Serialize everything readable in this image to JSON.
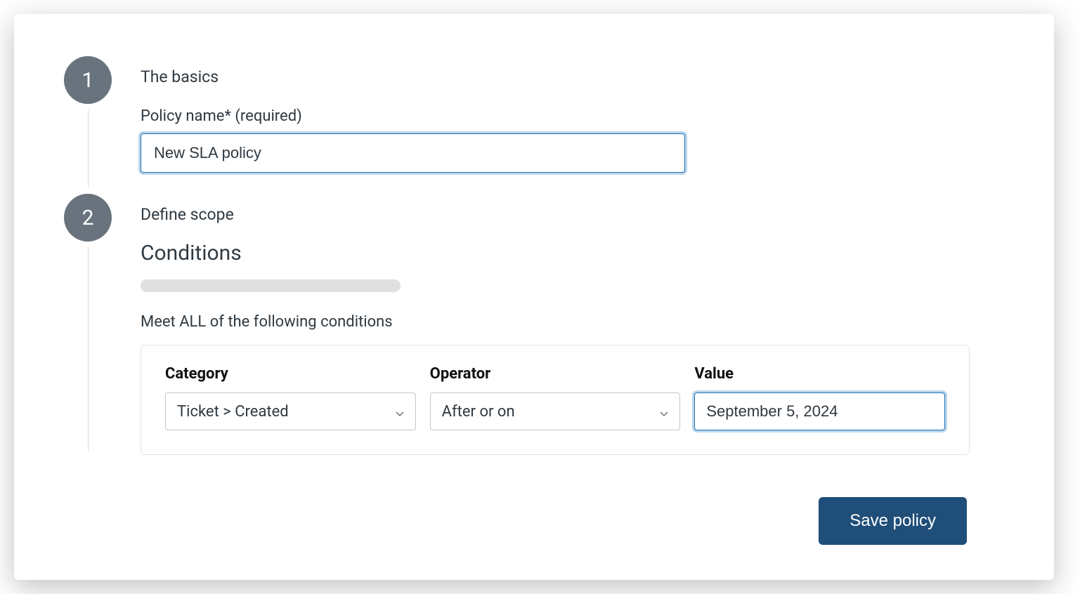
{
  "step1": {
    "number": "1",
    "title": "The basics",
    "policy_name_label": "Policy name* (required)",
    "policy_name_value": "New SLA policy"
  },
  "step2": {
    "number": "2",
    "title": "Define scope",
    "conditions_heading": "Conditions",
    "meet_all_label": "Meet ALL of the following conditions",
    "columns": {
      "category": "Category",
      "operator": "Operator",
      "value": "Value"
    },
    "row": {
      "category_value": "Ticket > Created",
      "operator_value": "After or on",
      "value_value": "September 5, 2024"
    }
  },
  "footer": {
    "save_label": "Save policy"
  }
}
